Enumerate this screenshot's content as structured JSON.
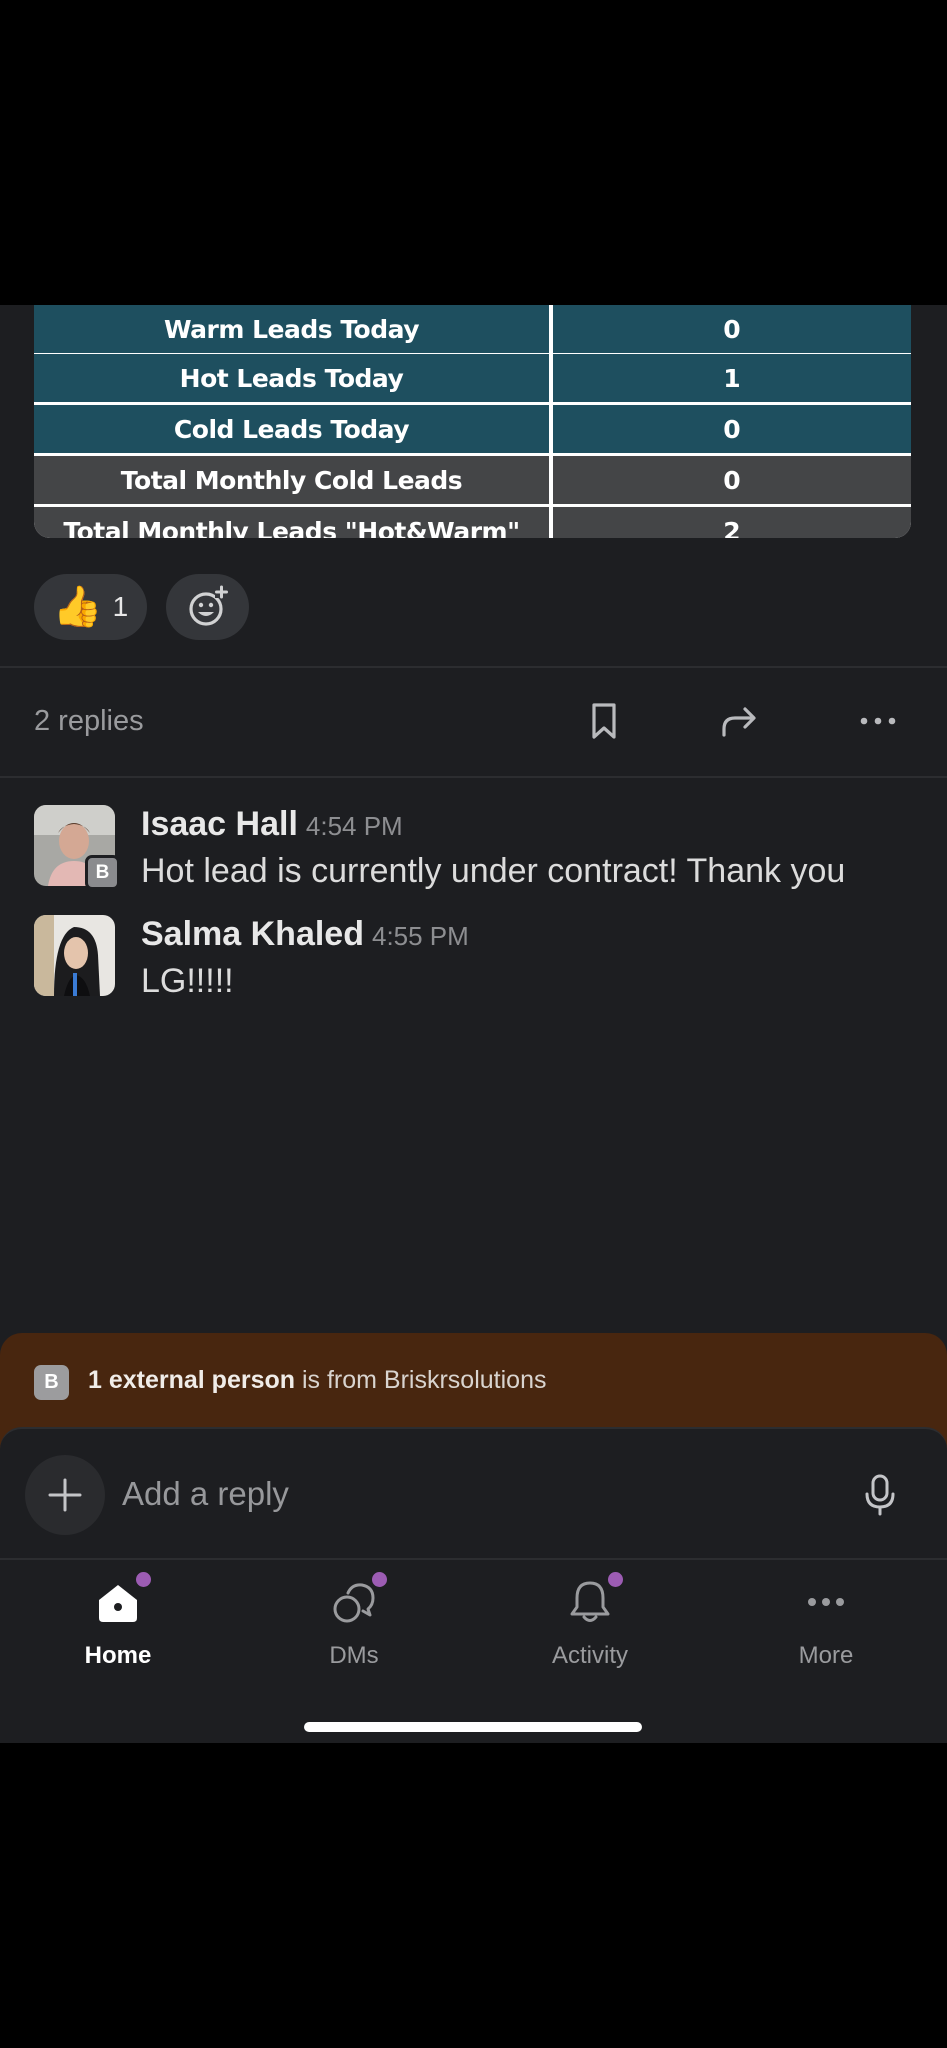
{
  "lead_table": {
    "rows": [
      {
        "label": "Warm Leads Today",
        "value": "0",
        "style": "teal"
      },
      {
        "label": "Hot Leads Today",
        "value": "1",
        "style": "teal"
      },
      {
        "label": "Cold Leads Today",
        "value": "0",
        "style": "teal"
      },
      {
        "label": "Total Monthly Cold Leads",
        "value": "0",
        "style": "gray"
      },
      {
        "label": "Total Monthly Leads \"Hot&Warm\"",
        "value": "2",
        "style": "gray"
      }
    ]
  },
  "reactions": {
    "thumbs_up": {
      "emoji": "👍",
      "count": "1"
    },
    "add_reaction_icon": "add-emoji-icon"
  },
  "thread": {
    "replies_label": "2 replies",
    "icons": [
      "bookmark-icon",
      "share-icon",
      "more-icon"
    ]
  },
  "messages": [
    {
      "author": "Isaac Hall",
      "time": "4:54 PM",
      "text": "Hot lead is currently under contract! Thank you",
      "badge": "B"
    },
    {
      "author": "Salma Khaled",
      "time": "4:55 PM",
      "text": "LG!!!!!"
    }
  ],
  "external_banner": {
    "badge": "B",
    "bold": "1 external person",
    "rest": " is from Briskrsolutions"
  },
  "composer": {
    "placeholder": "Add a reply"
  },
  "tabs": [
    {
      "label": "Home",
      "icon": "home-icon",
      "active": true,
      "dot": true
    },
    {
      "label": "DMs",
      "icon": "dms-icon",
      "active": false,
      "dot": true
    },
    {
      "label": "Activity",
      "icon": "bell-icon",
      "active": false,
      "dot": true
    },
    {
      "label": "More",
      "icon": "more-icon",
      "active": false,
      "dot": false
    }
  ],
  "colors": {
    "background": "#1d1e21",
    "table_teal": "#1e4f5f",
    "table_gray": "#444547",
    "banner": "#48260f",
    "notification_dot": "#9c5cb3"
  }
}
